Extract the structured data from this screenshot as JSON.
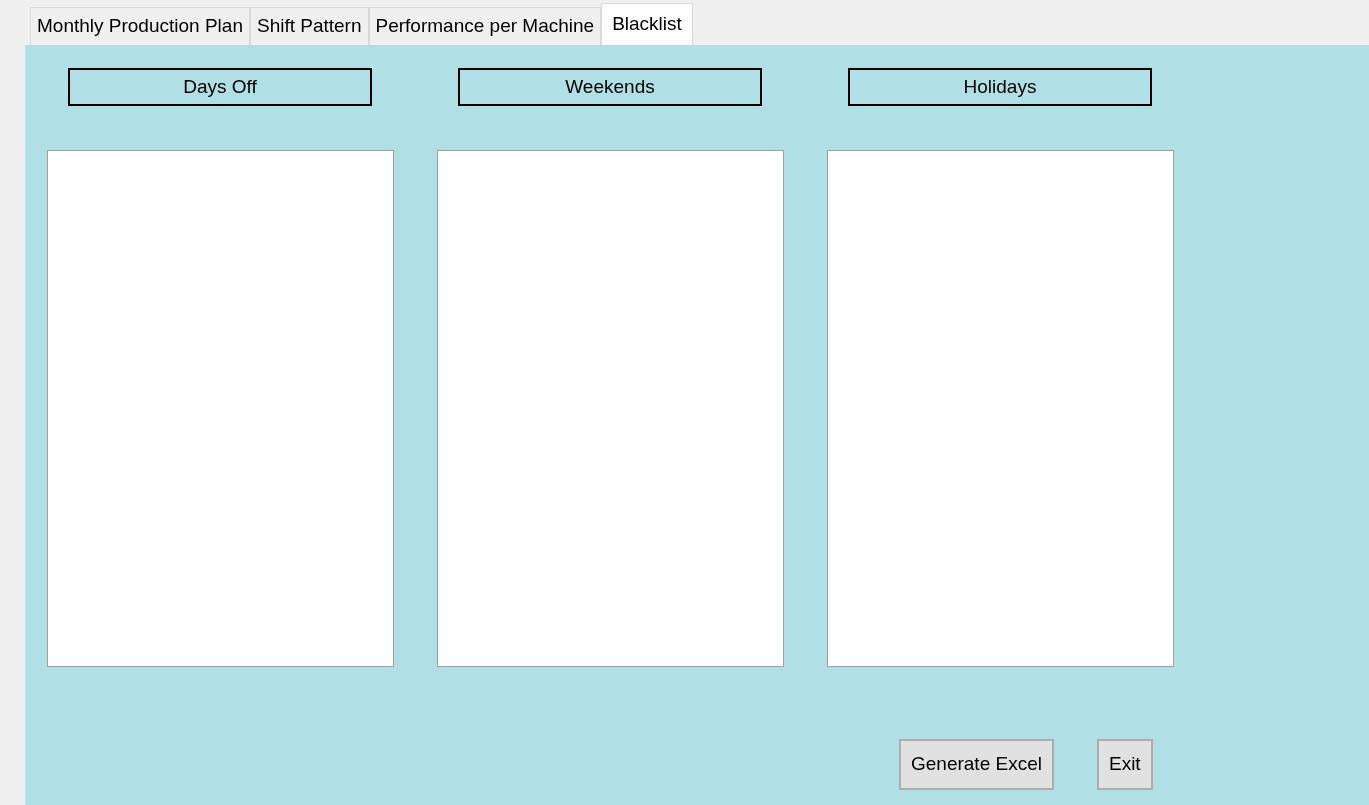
{
  "tabs": [
    {
      "label": "Monthly Production Plan",
      "selected": false
    },
    {
      "label": "Shift Pattern",
      "selected": false
    },
    {
      "label": "Performance per Machine",
      "selected": false
    },
    {
      "label": "Blacklist",
      "selected": true
    }
  ],
  "lists": [
    {
      "label": "Days Off"
    },
    {
      "label": "Weekends"
    },
    {
      "label": "Holidays"
    }
  ],
  "buttons": [
    {
      "label": "Generate Excel"
    },
    {
      "label": "Exit"
    }
  ]
}
